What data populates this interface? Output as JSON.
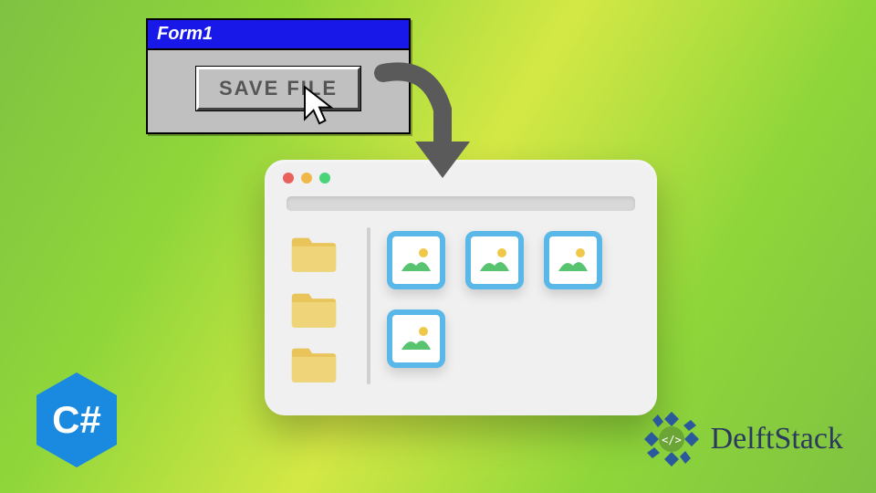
{
  "form": {
    "title": "Form1",
    "button_label": "SAVE FILE"
  },
  "browser": {
    "dots": [
      "red",
      "yellow",
      "green"
    ],
    "folders_count": 3,
    "images_count": 4
  },
  "csharp": {
    "label": "C#",
    "color": "#1a8ae0"
  },
  "brand": {
    "name": "DelftStack",
    "accent": "#2a5a9c"
  }
}
